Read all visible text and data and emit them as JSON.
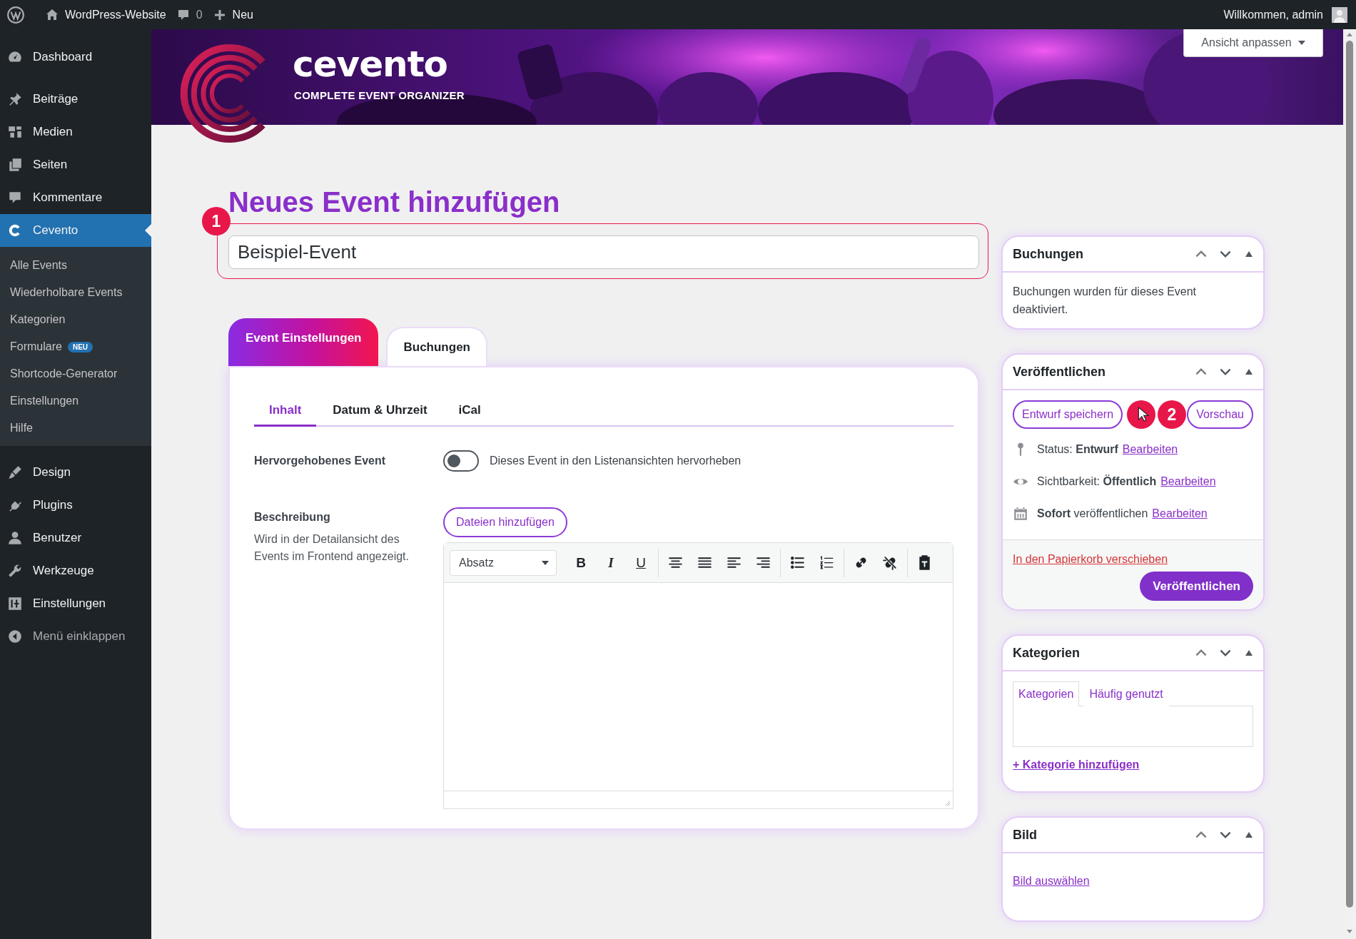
{
  "admin_bar": {
    "site_name": "WordPress-Website",
    "comments_count": "0",
    "new_label": "Neu",
    "greeting": "Willkommen, admin"
  },
  "sidebar": {
    "items": [
      {
        "label": "Dashboard",
        "kind": "menu",
        "selected": false
      },
      {
        "label": "Beiträge",
        "kind": "menu",
        "selected": false
      },
      {
        "label": "Medien",
        "kind": "menu",
        "selected": false
      },
      {
        "label": "Seiten",
        "kind": "menu",
        "selected": false
      },
      {
        "label": "Kommentare",
        "kind": "menu",
        "selected": false
      },
      {
        "label": "Cevento",
        "kind": "menu",
        "selected": true,
        "children": [
          {
            "label": "Alle Events",
            "selected": false
          },
          {
            "label": "Wiederholbare Events",
            "selected": false
          },
          {
            "label": "Kategorien",
            "selected": false
          },
          {
            "label": "Formulare",
            "badge": "NEU",
            "selected": false
          },
          {
            "label": "Shortcode-Generator",
            "selected": false
          },
          {
            "label": "Einstellungen",
            "selected": false
          },
          {
            "label": "Hilfe",
            "selected": false
          }
        ]
      },
      {
        "label": "Design",
        "kind": "menu",
        "selected": false
      },
      {
        "label": "Plugins",
        "kind": "menu",
        "selected": false
      },
      {
        "label": "Benutzer",
        "kind": "menu",
        "selected": false
      },
      {
        "label": "Werkzeuge",
        "kind": "menu",
        "selected": false
      },
      {
        "label": "Einstellungen",
        "kind": "menu",
        "selected": false
      },
      {
        "label": "Menü einklappen",
        "kind": "collapse",
        "selected": false
      }
    ]
  },
  "banner": {
    "brand": "cevento",
    "tagline": "COMPLETE EVENT ORGANIZER",
    "screen_options": "Ansicht anpassen"
  },
  "page": {
    "heading": "Neues Event hinzufügen",
    "title_value": "Beispiel-Event",
    "title_marker": "1"
  },
  "editor": {
    "tabs": [
      {
        "label": "Event Einstellungen",
        "selected": true
      },
      {
        "label": "Buchungen",
        "selected": false
      }
    ],
    "sub_tabs": [
      {
        "label": "Inhalt",
        "selected": true
      },
      {
        "label": "Datum & Uhrzeit",
        "selected": false
      },
      {
        "label": "iCal",
        "selected": false
      }
    ],
    "featured": {
      "label": "Hervorgehobenes Event",
      "on": false,
      "description": "Dieses Event in den Listenansichten hervorheben"
    },
    "description": {
      "label": "Beschreibung",
      "help": "Wird in der Detailansicht des Events im Frontend angezeigt.",
      "add_media": "Dateien hinzufügen",
      "format": "Absatz",
      "format_letters": [
        "B",
        "I",
        "U"
      ]
    }
  },
  "boxes": [
    {
      "kind": "notice",
      "title": "Buchungen",
      "text": "Buchungen wurden für dieses Event deaktiviert."
    },
    {
      "kind": "publish",
      "title": "Veröffentlichen",
      "save_draft": "Entwurf speichern",
      "marker": "2",
      "preview": "Vorschau",
      "rows": [
        {
          "text": "Status: **Entwurf**",
          "link": "Bearbeiten"
        },
        {
          "text": "Sichtbarkeit: **Öffentlich**",
          "link": "Bearbeiten"
        },
        {
          "text": "**Sofort** veröffentlichen",
          "link": "Bearbeiten"
        }
      ],
      "trash": "In den Papierkorb verschieben",
      "publish": "Veröffentlichen"
    },
    {
      "kind": "categories",
      "title": "Kategorien",
      "tabs": [
        {
          "label": "Kategorien",
          "selected": true
        },
        {
          "label": "Häufig genutzt",
          "selected": false
        }
      ],
      "add_link": "+ Kategorie hinzufügen"
    },
    {
      "title": "Bild",
      "link": "Bild auswählen"
    }
  ]
}
